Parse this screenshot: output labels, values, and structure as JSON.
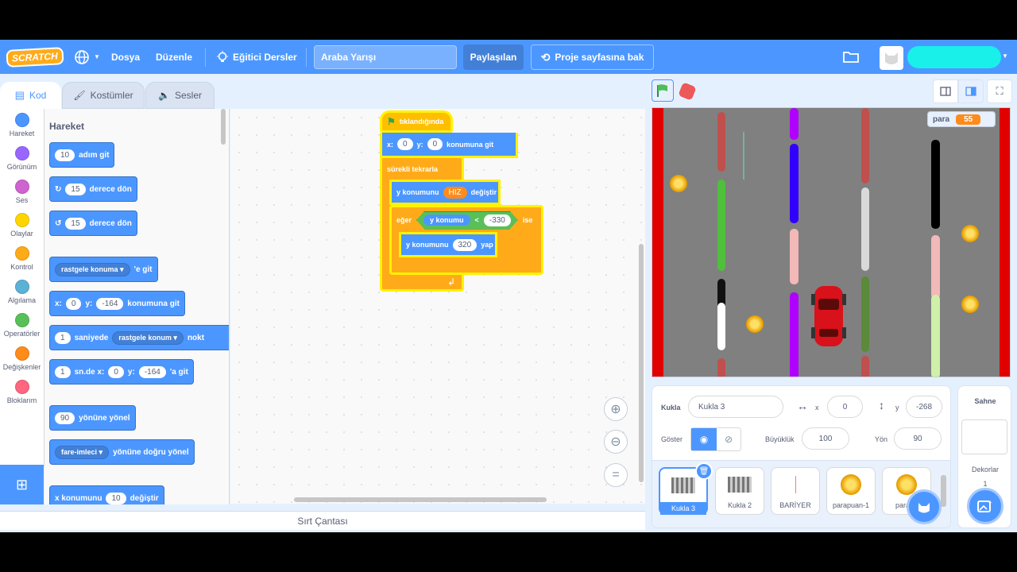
{
  "topbar": {
    "logo": "SCRATCH",
    "file_menu": "Dosya",
    "edit_menu": "Düzenle",
    "tutorials": "Eğitici Dersler",
    "project_title": "Araba Yarışı",
    "share_button": "Paylaşılan",
    "project_page_button": "Proje sayfasına bak"
  },
  "tabs": {
    "code": "Kod",
    "costumes": "Kostümler",
    "sounds": "Sesler"
  },
  "categories": [
    {
      "label": "Hareket",
      "color": "#4c97ff"
    },
    {
      "label": "Görünüm",
      "color": "#9966ff"
    },
    {
      "label": "Ses",
      "color": "#cf63cf"
    },
    {
      "label": "Olaylar",
      "color": "#ffd500"
    },
    {
      "label": "Kontrol",
      "color": "#ffab19"
    },
    {
      "label": "Algılama",
      "color": "#5cb1d6"
    },
    {
      "label": "Operatörler",
      "color": "#59c059"
    },
    {
      "label": "Değişkenler",
      "color": "#ff8c1a"
    },
    {
      "label": "Bloklarım",
      "color": "#ff6680"
    }
  ],
  "palette": {
    "heading": "Hareket",
    "b1": {
      "n": "10",
      "t": "adım git"
    },
    "b2": {
      "n": "15",
      "t": "derece dön"
    },
    "b3": {
      "n": "15",
      "t": "derece dön"
    },
    "b4": {
      "d": "rastgele konuma",
      "t": "'e git"
    },
    "b5": {
      "x": "x:",
      "xv": "0",
      "y": "y:",
      "yv": "-164",
      "t": "konumuna git"
    },
    "b6": {
      "n": "1",
      "t": "saniyede",
      "d": "rastgele konum",
      "t2": "nokt"
    },
    "b7": {
      "n": "1",
      "t": "sn.de x:",
      "xv": "0",
      "y": "y:",
      "yv": "-164",
      "t2": "'a git"
    },
    "b8": {
      "n": "90",
      "t": "yönüne yönel"
    },
    "b9": {
      "d": "fare-imleci",
      "t": "yönüne doğru yönel"
    },
    "b10": {
      "t": "x konumunu",
      "n": "10",
      "t2": "değiştir"
    }
  },
  "script": {
    "hat": "tıklandığında",
    "goto": {
      "x": "x:",
      "xv": "0",
      "y": "y:",
      "yv": "0",
      "t": "konumuna git"
    },
    "forever": "sürekli tekrarla",
    "change_y": {
      "t": "y konumunu",
      "v": "HIZ",
      "t2": "değiştir"
    },
    "if": {
      "t": "eğer",
      "rep": "y konumu",
      "op": "<",
      "v": "-330",
      "t2": "ise"
    },
    "set_y": {
      "t": "y konumunu",
      "v": "320",
      "t2": "yap"
    }
  },
  "backpack": "Sırt Çantası",
  "stage": {
    "var_name": "para",
    "var_value": "55"
  },
  "sprite_info": {
    "sprite_label": "Kukla",
    "sprite_name": "Kukla 3",
    "x_label": "x",
    "x": "0",
    "y_label": "y",
    "y": "-268",
    "show_label": "Göster",
    "size_label": "Büyüklük",
    "size": "100",
    "direction_label": "Yön",
    "direction": "90"
  },
  "sprites": [
    "Kukla 3",
    "Kukla 2",
    "BARİYER",
    "parapuan-1",
    "parap"
  ],
  "stage_pane": {
    "title": "Sahne",
    "backdrops_label": "Dekorlar",
    "backdrops_count": "1"
  }
}
